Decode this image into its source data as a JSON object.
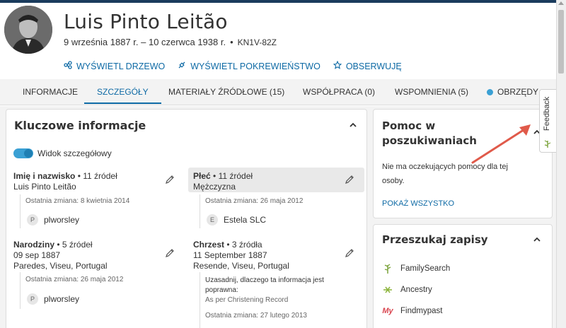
{
  "person": {
    "name": "Luis Pinto Leitão",
    "lifespan": "9 września 1887 r. – 10 czerwca 1938 r.",
    "separator": "•",
    "id": "KN1V-82Z"
  },
  "actions": [
    {
      "label": "WYŚWIETL DRZEWO",
      "icon": "tree-icon"
    },
    {
      "label": "WYŚWIETL POKREWIEŃSTWO",
      "icon": "relationship-icon"
    },
    {
      "label": "OBSERWUJĘ",
      "icon": "star-icon"
    }
  ],
  "tabs": [
    {
      "label": "INFORMACJE"
    },
    {
      "label": "SZCZEGÓŁY",
      "active": true
    },
    {
      "label": "MATERIAŁY ŹRÓDŁOWE (15)"
    },
    {
      "label": "WSPÓŁPRACA (0)"
    },
    {
      "label": "WSPOMNIENIA (5)"
    },
    {
      "label": "OBRZĘDY"
    }
  ],
  "key_info": {
    "title": "Kluczowe informacje",
    "toggle_label": "Widok szczegółowy",
    "toggle_on": true,
    "facts": {
      "name": {
        "label": "Imię i nazwisko",
        "sources": "• 11 źródeł",
        "value": "Luis Pinto Leitão",
        "changed": "Ostatnia zmiana: 8 kwietnia 2014",
        "contributor_initial": "P",
        "contributor": "plworsley"
      },
      "sex": {
        "label": "Płeć",
        "sources": "• 11 źródeł",
        "value": "Mężczyzna",
        "changed": "Ostatnia zmiana: 26 maja 2012",
        "contributor_initial": "E",
        "contributor": "Estela SLC"
      },
      "birth": {
        "label": "Narodziny",
        "sources": "• 5 źródeł",
        "date": "09 sep 1887",
        "place": "Paredes, Viseu, Portugal",
        "changed": "Ostatnia zmiana: 26 maja 2012",
        "contributor_initial": "P",
        "contributor": "plworsley"
      },
      "christening": {
        "label": "Chrzest",
        "sources": "• 3 źródła",
        "date": "11 September 1887",
        "place": "Resende, Viseu, Portugal",
        "reason_line1": "Uzasadnij, dlaczego ta informacja jest",
        "reason_line2": "poprawna:",
        "reason_value": "As per Christening Record",
        "changed": "Ostatnia zmiana: 27 lutego 2013"
      }
    }
  },
  "help": {
    "title_line1": "Pomoc w",
    "title_line2": "poszukiwaniach",
    "text_line1": "Nie ma oczekujących pomocy dla tej",
    "text_line2": "osoby.",
    "show_all": "POKAŻ WSZYSTKO"
  },
  "search_records": {
    "title": "Przeszukaj zapisy",
    "items": [
      {
        "label": "FamilySearch",
        "icon": "familysearch-tree-icon"
      },
      {
        "label": "Ancestry",
        "icon": "ancestry-leaf-icon"
      },
      {
        "label": "Findmypast",
        "icon": "findmypast-logo-icon",
        "glyph": "My"
      }
    ]
  },
  "feedback": {
    "label": "Feedback"
  },
  "colors": {
    "accent": "#0e6aa5",
    "toggle": "#3aa0d4",
    "annotation_arrow": "#e05a4a",
    "top_bar": "#1a3b5d"
  }
}
